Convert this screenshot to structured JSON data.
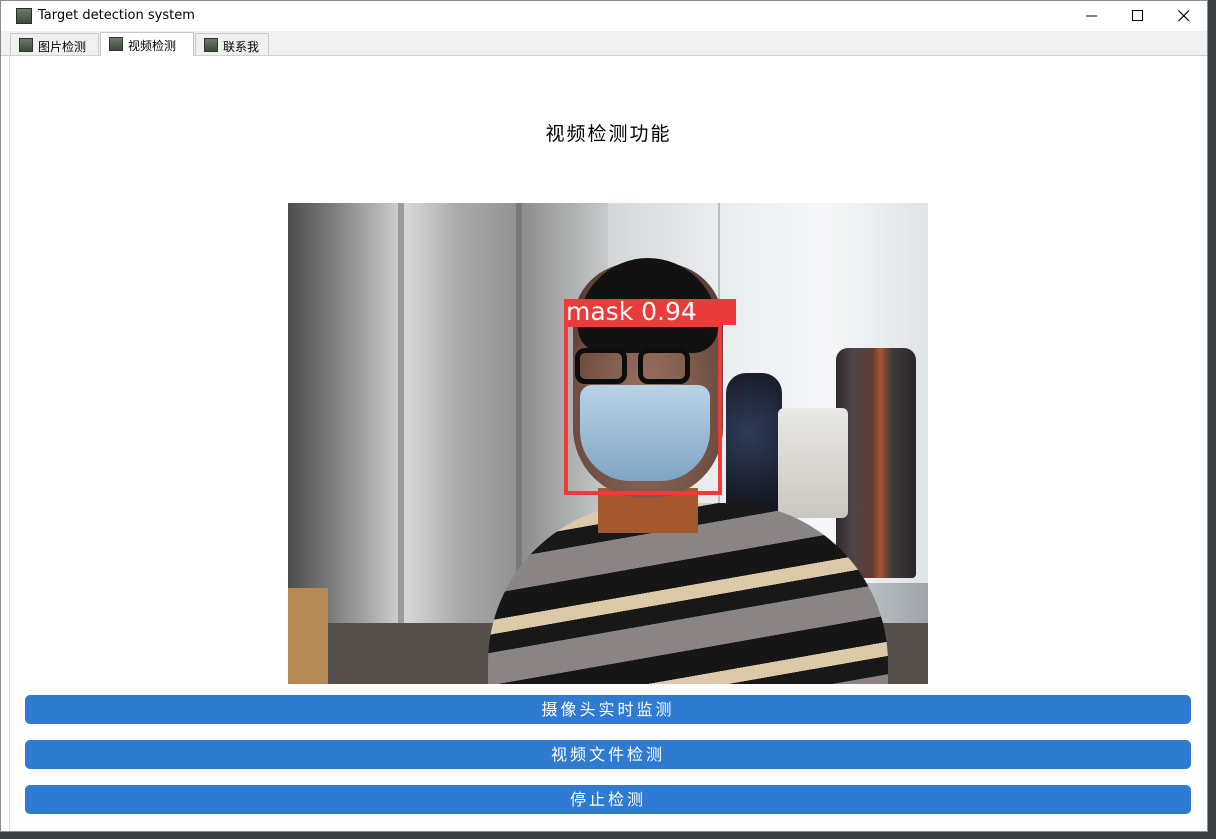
{
  "window": {
    "title": "Target detection system"
  },
  "tabs": [
    {
      "label": "图片检测",
      "active": false
    },
    {
      "label": "视频检测",
      "active": true
    },
    {
      "label": "联系我",
      "active": false
    }
  ],
  "main": {
    "title": "视频检测功能",
    "detection": {
      "label": "mask 0.94",
      "color": "#ec3b3b"
    },
    "buttons": {
      "camera": "摄像头实时监测",
      "video_file": "视频文件检测",
      "stop": "停止检测"
    },
    "accent_color": "#2f7bd2"
  },
  "icons": {
    "app": "app-icon",
    "minimize": "minimize-icon",
    "maximize": "maximize-icon",
    "close": "close-icon"
  }
}
